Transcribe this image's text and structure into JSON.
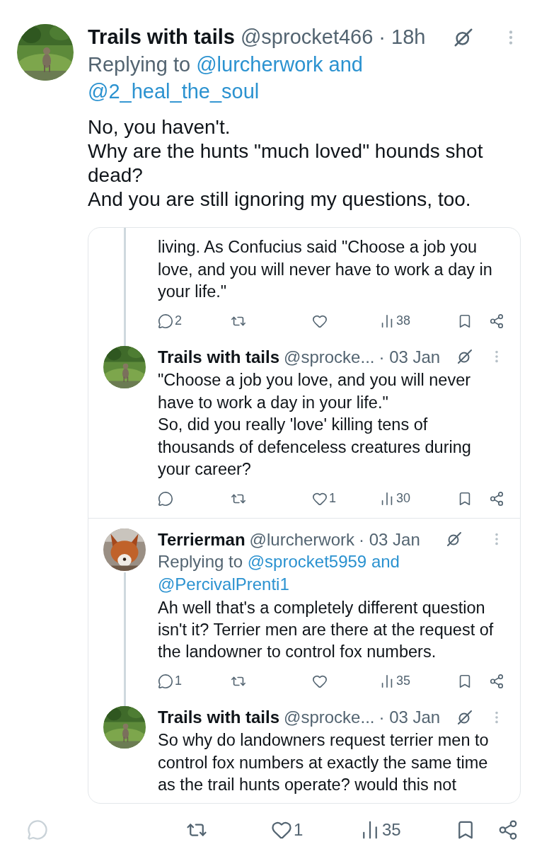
{
  "post": {
    "author": "Trails with tails",
    "handle": "@sprocket466",
    "time": "· 18h",
    "replying": {
      "prefix": "Replying to",
      "mentions": [
        "@lurcherwork and",
        "@2_heal_the_soul"
      ]
    },
    "body": [
      "No, you haven't.",
      "Why are the hunts \"much loved\" hounds shot dead?",
      "And you are still ignoring my questions, too."
    ]
  },
  "thread": [
    {
      "kind": "fragment",
      "connected_below": true,
      "body": [
        "living. As Confucius said \"Choose a job you love, and you will never have to work a day in your life.\""
      ],
      "actions": {
        "replies": "2",
        "views": "38"
      }
    },
    {
      "kind": "reply",
      "connected_below": false,
      "author": "Trails with tails",
      "handle": "@sprocke...",
      "time": "· 03 Jan",
      "body": [
        "\"Choose a job you love, and you will never have to work a day in your life.\"",
        "So, did you really 'love' killing tens of thousands of defenceless creatures during your career?"
      ],
      "actions": {
        "likes": "1",
        "views": "30"
      }
    },
    {
      "kind": "reply",
      "connected_below": true,
      "author": "Terrierman",
      "handle": "@lurcherwork",
      "time": "· 03 Jan",
      "replying": {
        "prefix": "Replying to",
        "mentions": [
          "@sprocket5959 and",
          "@PercivalPrenti1"
        ]
      },
      "body": [
        "Ah well that's a completely different question isn't it? Terrier men are there at the request of the landowner to control fox numbers."
      ],
      "actions": {
        "replies": "1",
        "views": "35"
      }
    },
    {
      "kind": "reply",
      "connected_below": false,
      "author": "Trails with tails",
      "handle": "@sprocke...",
      "time": "· 03 Jan",
      "body": [
        "So why do landowners request terrier men to control fox numbers at exactly the same time as the trail hunts operate?  would this not"
      ]
    }
  ],
  "actions": {
    "likes": "1",
    "views": "35"
  }
}
